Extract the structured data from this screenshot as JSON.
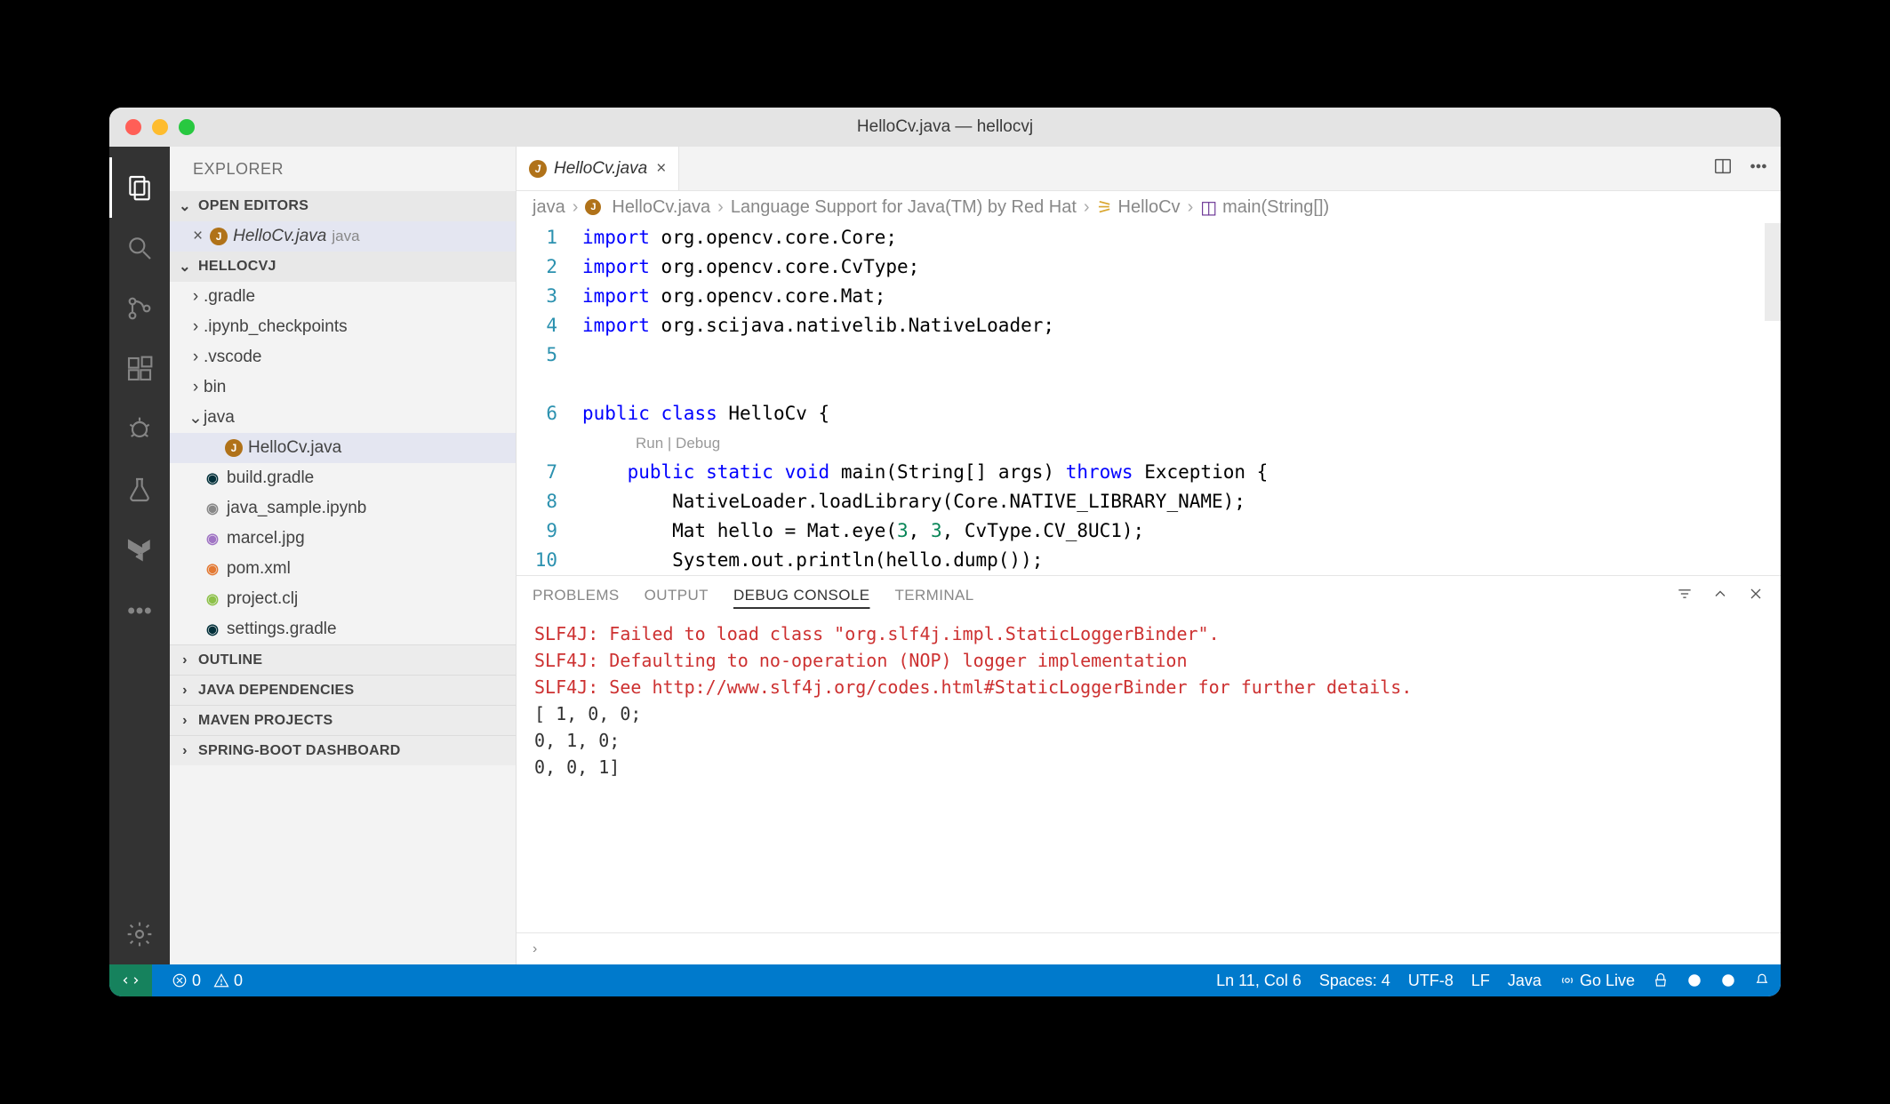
{
  "window": {
    "title": "HelloCv.java — hellocvj"
  },
  "explorer": {
    "title": "EXPLORER"
  },
  "openEditors": {
    "title": "OPEN EDITORS",
    "items": [
      {
        "name": "HelloCv.java",
        "hint": "java"
      }
    ]
  },
  "project": {
    "title": "HELLOCVJ",
    "tree": [
      {
        "type": "folder",
        "name": ".gradle",
        "depth": 0,
        "open": false
      },
      {
        "type": "folder",
        "name": ".ipynb_checkpoints",
        "depth": 0,
        "open": false
      },
      {
        "type": "folder",
        "name": ".vscode",
        "depth": 0,
        "open": false
      },
      {
        "type": "folder",
        "name": "bin",
        "depth": 0,
        "open": false
      },
      {
        "type": "folder",
        "name": "java",
        "depth": 0,
        "open": true
      },
      {
        "type": "file",
        "name": "HelloCv.java",
        "depth": 1,
        "icon": "java",
        "selected": true
      },
      {
        "type": "file",
        "name": "build.gradle",
        "depth": 0,
        "icon": "gradle"
      },
      {
        "type": "file",
        "name": "java_sample.ipynb",
        "depth": 0,
        "icon": "ipynb"
      },
      {
        "type": "file",
        "name": "marcel.jpg",
        "depth": 0,
        "icon": "image"
      },
      {
        "type": "file",
        "name": "pom.xml",
        "depth": 0,
        "icon": "xml"
      },
      {
        "type": "file",
        "name": "project.clj",
        "depth": 0,
        "icon": "clj"
      },
      {
        "type": "file",
        "name": "settings.gradle",
        "depth": 0,
        "icon": "gradle"
      }
    ]
  },
  "collapsedSections": [
    "OUTLINE",
    "JAVA DEPENDENCIES",
    "MAVEN PROJECTS",
    "SPRING-BOOT DASHBOARD"
  ],
  "tab": {
    "title": "HelloCv.java"
  },
  "breadcrumb": [
    "java",
    "HelloCv.java",
    "Language Support for Java(TM) by Red Hat",
    "HelloCv",
    "main(String[])"
  ],
  "code": {
    "lineNumbers": [
      "1",
      "2",
      "3",
      "4",
      "5",
      "",
      "6",
      "",
      "7",
      "8",
      "9",
      "10"
    ],
    "codelens": "Run | Debug",
    "lines": [
      [
        {
          "t": "import",
          "c": "kw"
        },
        {
          "t": " org.opencv.core.Core;"
        }
      ],
      [
        {
          "t": "import",
          "c": "kw"
        },
        {
          "t": " org.opencv.core.CvType;"
        }
      ],
      [
        {
          "t": "import",
          "c": "kw"
        },
        {
          "t": " org.opencv.core.Mat;"
        }
      ],
      [
        {
          "t": "import",
          "c": "kw"
        },
        {
          "t": " org.scijava.nativelib.NativeLoader;"
        }
      ],
      [],
      [],
      [
        {
          "t": "public",
          "c": "kw"
        },
        {
          "t": " "
        },
        {
          "t": "class",
          "c": "kw"
        },
        {
          "t": " HelloCv {"
        }
      ],
      [],
      [
        {
          "t": "    "
        },
        {
          "t": "public",
          "c": "kw"
        },
        {
          "t": " "
        },
        {
          "t": "static",
          "c": "kw"
        },
        {
          "t": " "
        },
        {
          "t": "void",
          "c": "kw"
        },
        {
          "t": " main(String[] args) "
        },
        {
          "t": "throws",
          "c": "kw"
        },
        {
          "t": " Exception {"
        }
      ],
      [
        {
          "t": "        NativeLoader.loadLibrary(Core.NATIVE_LIBRARY_NAME);"
        }
      ],
      [
        {
          "t": "        Mat hello = Mat.eye("
        },
        {
          "t": "3",
          "c": "num"
        },
        {
          "t": ", "
        },
        {
          "t": "3",
          "c": "num"
        },
        {
          "t": ", CvType.CV_8UC1);"
        }
      ],
      [
        {
          "t": "        System.out.println(hello.dump());"
        }
      ]
    ]
  },
  "panel": {
    "tabs": [
      "PROBLEMS",
      "OUTPUT",
      "DEBUG CONSOLE",
      "TERMINAL"
    ],
    "active": "DEBUG CONSOLE",
    "lines": [
      {
        "text": "SLF4J: Failed to load class \"org.slf4j.impl.StaticLoggerBinder\".",
        "err": true
      },
      {
        "text": "SLF4J: Defaulting to no-operation (NOP) logger implementation",
        "err": true
      },
      {
        "text": "SLF4J: See http://www.slf4j.org/codes.html#StaticLoggerBinder for further details.",
        "err": true
      },
      {
        "text": "[  1,   0,   0;",
        "err": false
      },
      {
        "text": "   0,   1,   0;",
        "err": false
      },
      {
        "text": "   0,   0,   1]",
        "err": false
      }
    ]
  },
  "status": {
    "errors": "0",
    "warnings": "0",
    "cursor": "Ln 11, Col 6",
    "spaces": "Spaces: 4",
    "encoding": "UTF-8",
    "eol": "LF",
    "lang": "Java",
    "live": "Go Live"
  }
}
